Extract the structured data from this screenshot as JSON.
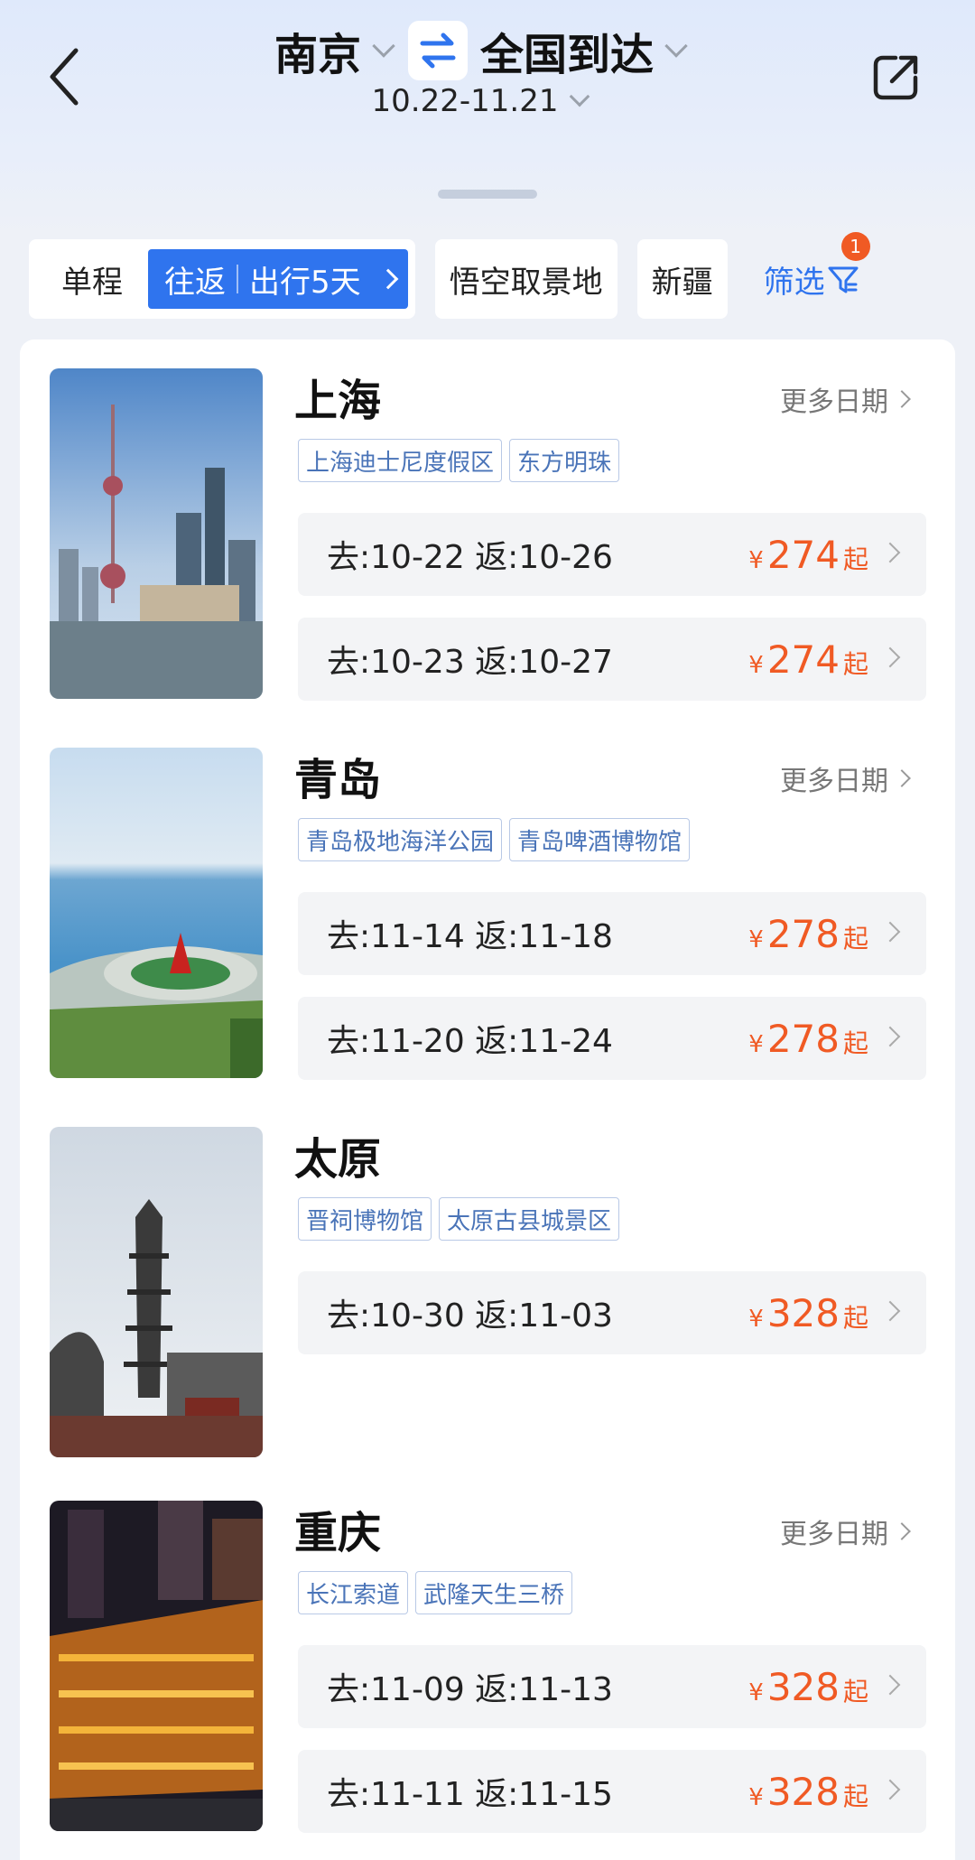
{
  "header": {
    "origin": "南京",
    "destination": "全国到达",
    "date_range": "10.22-11.21"
  },
  "filters": {
    "one_way": "单程",
    "round_trip": "往返",
    "duration": "出行5天",
    "chips": [
      "悟空取景地",
      "新疆"
    ],
    "filter_label": "筛选",
    "filter_badge": "1"
  },
  "destinations": [
    {
      "name": "上海",
      "more_label": "更多日期",
      "tags": [
        "上海迪士尼度假区",
        "东方明珠"
      ],
      "trips": [
        {
          "dates": "去:10-22 返:10-26",
          "currency": "¥",
          "price": "274",
          "suffix": "起"
        },
        {
          "dates": "去:10-23 返:10-27",
          "currency": "¥",
          "price": "274",
          "suffix": "起"
        }
      ]
    },
    {
      "name": "青岛",
      "more_label": "更多日期",
      "tags": [
        "青岛极地海洋公园",
        "青岛啤酒博物馆"
      ],
      "trips": [
        {
          "dates": "去:11-14 返:11-18",
          "currency": "¥",
          "price": "278",
          "suffix": "起"
        },
        {
          "dates": "去:11-20 返:11-24",
          "currency": "¥",
          "price": "278",
          "suffix": "起"
        }
      ]
    },
    {
      "name": "太原",
      "more_label": "",
      "tags": [
        "晋祠博物馆",
        "太原古县城景区"
      ],
      "trips": [
        {
          "dates": "去:10-30 返:11-03",
          "currency": "¥",
          "price": "328",
          "suffix": "起"
        }
      ]
    },
    {
      "name": "重庆",
      "more_label": "更多日期",
      "tags": [
        "长江索道",
        "武隆天生三桥"
      ],
      "trips": [
        {
          "dates": "去:11-09 返:11-13",
          "currency": "¥",
          "price": "328",
          "suffix": "起"
        },
        {
          "dates": "去:11-11 返:11-15",
          "currency": "¥",
          "price": "328",
          "suffix": "起"
        }
      ]
    }
  ],
  "colors": {
    "accent": "#2f74ee",
    "price": "#f05a24"
  }
}
